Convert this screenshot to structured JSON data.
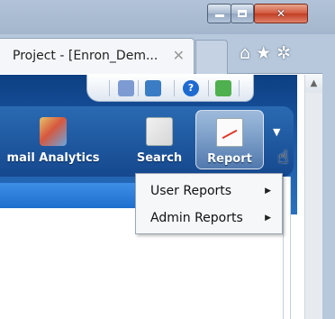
{
  "window": {
    "minimize": "▁",
    "close": "✕"
  },
  "tab": {
    "title": "Project - [Enron_Dem...",
    "close": "✕"
  },
  "browser_icons": {
    "home": "⌂",
    "favorites": "★",
    "settings": "✲"
  },
  "utility_icons": [
    "user-icon",
    "book-icon",
    "help-icon",
    "exit-icon"
  ],
  "toolbar": {
    "items": [
      {
        "label": "mail Analytics",
        "icon": "people-chart-icon"
      },
      {
        "label": "Search",
        "icon": "search-document-icon"
      },
      {
        "label": "Report",
        "icon": "report-chart-icon"
      }
    ]
  },
  "menu": {
    "items": [
      {
        "label": "User Reports",
        "arrow": "▶"
      },
      {
        "label": "Admin Reports",
        "arrow": "▶"
      }
    ]
  },
  "colors": {
    "banner": "#1a58a6",
    "title_bar": "#b2c3d8",
    "menu_bg": "#f6f7f9"
  }
}
